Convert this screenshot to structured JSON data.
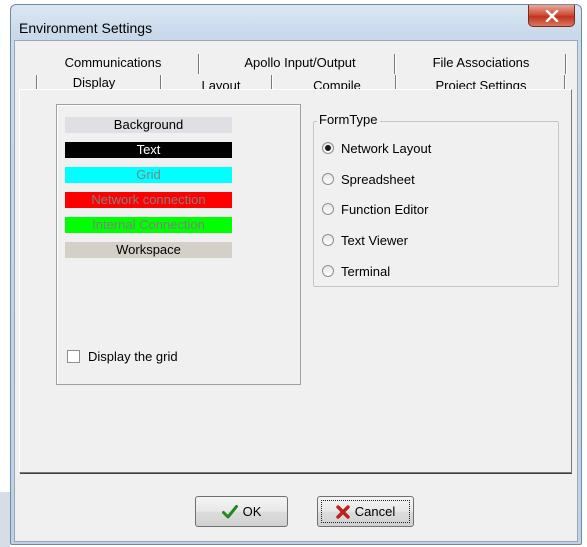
{
  "window": {
    "title": "Environment Settings",
    "close_icon": "close-x-icon"
  },
  "tabs": {
    "back_row": [
      "Communications",
      "Apollo Input/Output",
      "File Associations"
    ],
    "front_row": [
      "Display",
      "Layout",
      "Compile",
      "Project Settings"
    ],
    "active": "Display"
  },
  "colors": {
    "items": [
      {
        "label": "Background",
        "bg": "#e0dfe3",
        "fg": "#000000"
      },
      {
        "label": "Text",
        "bg": "#000000",
        "fg": "#ffffff"
      },
      {
        "label": "Grid",
        "bg": "#00ffff",
        "fg": "#808080"
      },
      {
        "label": "Network connection",
        "bg": "#ff0000",
        "fg": "#808080"
      },
      {
        "label": "Internal Connection",
        "bg": "#00ff00",
        "fg": "#808080"
      },
      {
        "label": "Workspace",
        "bg": "#d4d0c8",
        "fg": "#000000"
      }
    ]
  },
  "display_grid": {
    "label": "Display the grid",
    "checked": false
  },
  "formtype": {
    "label": "FormType",
    "options": [
      "Network Layout",
      "Spreadsheet",
      "Function Editor",
      "Text Viewer",
      "Terminal"
    ],
    "selected": "Network Layout"
  },
  "buttons": {
    "ok": "OK",
    "cancel": "Cancel"
  }
}
